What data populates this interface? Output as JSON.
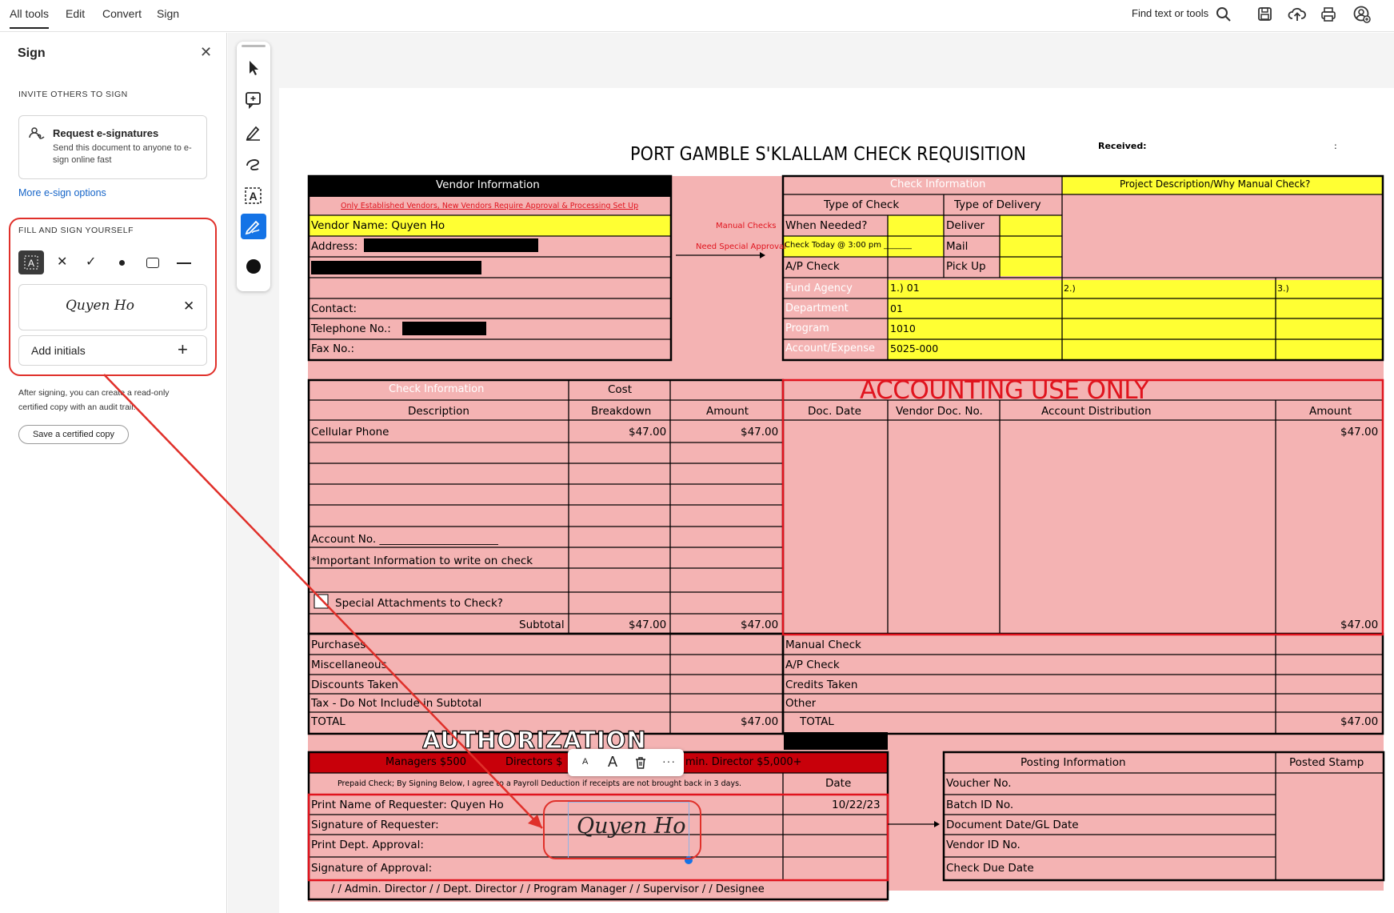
{
  "topbar": {
    "nav": [
      "All tools",
      "Edit",
      "Convert",
      "Sign"
    ],
    "find_label": "Find text or tools"
  },
  "sign_panel": {
    "title": "Sign",
    "invite_heading": "INVITE OTHERS TO SIGN",
    "request_title": "Request e-signatures",
    "request_desc_1": "Send this document to anyone to e-",
    "request_desc_2": "sign online fast",
    "more_options": "More e-sign options",
    "fill_heading": "FILL AND SIGN YOURSELF",
    "signature_text": "Quyen Ho",
    "add_initials": "Add initials",
    "note_1": "After signing, you can create a read-only",
    "note_2": "certified copy with an audit trail.",
    "save_certified": "Save a certified copy"
  },
  "form": {
    "title": "PORT GAMBLE S'KLALLAM CHECK REQUISITION",
    "received": "Received:",
    "received_colon": ":",
    "vendor_info": "Vendor Information",
    "vendor_note": "Only Established Vendors, New Vendors Require Approval & Processing Set Up",
    "vendor_name": "Vendor Name: Quyen Ho",
    "address": "Address:",
    "contact": "Contact:",
    "telephone": "Telephone No.:",
    "fax": "Fax No.:",
    "manual_checks": "Manual Checks",
    "need_special": "Need Special Approval",
    "check_info": "Check Information",
    "project_desc": "Project Description/Why Manual Check?",
    "type_check": "Type of Check",
    "type_delivery": "Type of Delivery",
    "when_needed": "When Needed?",
    "deliver": "Deliver",
    "check_today": "Check Today @ 3:00 pm _______",
    "mail": "Mail",
    "ap_check": "A/P Check",
    "pickup": "Pick Up",
    "fund_agency": "Fund Agency",
    "fund_1": "1.)    01",
    "fund_2": "2.)",
    "fund_3": "3.)",
    "department": "Department",
    "department_val": "01",
    "program": "Program",
    "program_val": "1010",
    "account_expense": "Account/Expense",
    "account_val": "5025-000",
    "check_info2": "Check Information",
    "description": "Description",
    "cost": "Cost",
    "breakdown": "Breakdown",
    "amount": "Amount",
    "accounting_use": "ACCOUNTING USE ONLY",
    "doc_date": "Doc. Date",
    "vendor_doc_no": "Vendor Doc. No.",
    "account_dist": "Account Distribution",
    "amount2": "Amount",
    "cellular": "Cellular Phone",
    "amt_47": "$47.00",
    "account_no": "Account No. ______________________",
    "important": "*Important Information to write on check",
    "special_attach": "Special Attachments to Check?",
    "subtotal": "Subtotal",
    "purchases": "Purchases",
    "misc": "Miscellaneous",
    "discounts": "Discounts Taken",
    "tax": "Tax - Do Not Include in Subtotal",
    "total": "TOTAL",
    "manual_check": "Manual Check",
    "ap_check2": "A/P Check",
    "credits": "Credits Taken",
    "other": "Other",
    "total2": "TOTAL",
    "authorization": "AUTHORIZATION",
    "managers": "Managers $500",
    "directors": "Directors $",
    "admin_dir": "min. Director $5,000+",
    "prepaid": "Prepaid Check; By Signing Below, I  agree to a Payroll Deduction if receipts are not brought back in 3 days.",
    "date": "Date",
    "print_name": "Print Name of Requester:   Quyen Ho",
    "date_val": "10/22/23",
    "sig_requester": "Signature of Requester:",
    "print_dept": "Print Dept. Approval:",
    "sig_approval": "Signature of Approval:",
    "footer_line": "/ / Admin. Director    / / Dept. Director    / / Program Manager   / / Supervisor   / / Designee",
    "posting_info": "Posting Information",
    "posted_stamp": "Posted Stamp",
    "voucher": "Voucher No.",
    "batch": "Batch ID No.",
    "docdate_gl": "Document Date/GL Date",
    "vendor_id": "Vendor ID No.",
    "check_due": "Check Due Date",
    "signature_placed": "Quyen Ho"
  },
  "colors": {
    "pink": "#f4b3b3",
    "yellow": "#ffff33",
    "red_header": "#c8000a",
    "black": "#000000",
    "accent_blue": "#1473e6",
    "annotation_red": "#e0302a"
  }
}
